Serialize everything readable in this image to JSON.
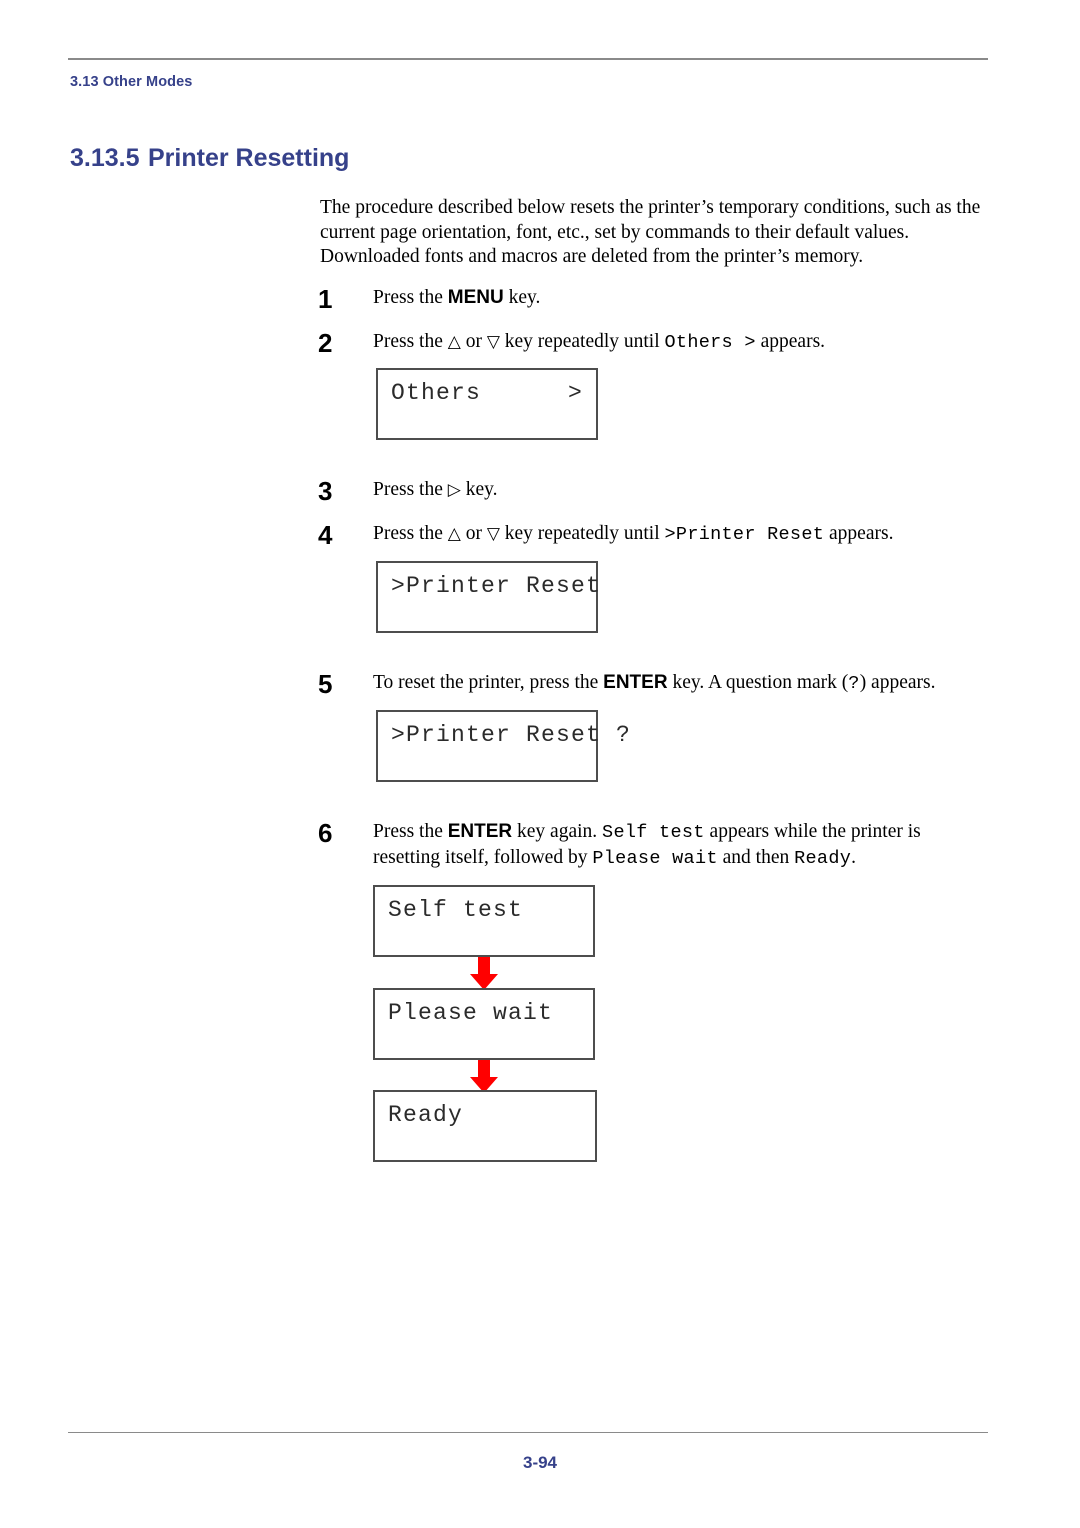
{
  "page": {
    "running_header": "3.13 Other Modes",
    "footer_page_number": "3-94",
    "heading_color": "#36418a",
    "arrow_color": "#ff0000"
  },
  "heading": {
    "number": "3.13.5",
    "title": "Printer Resetting"
  },
  "intro": {
    "paragraph": "The procedure described below resets the printer’s temporary conditions, such as the current page orientation, font, etc., set by commands to their default values. Downloaded fonts and macros are deleted from the printer’s memory."
  },
  "steps": [
    {
      "number": "1",
      "parts": [
        {
          "type": "text",
          "value": "Press the "
        },
        {
          "type": "key",
          "value": "MENU"
        },
        {
          "type": "text",
          "value": " key."
        }
      ]
    },
    {
      "number": "2",
      "parts": [
        {
          "type": "text",
          "value": "Press the "
        },
        {
          "type": "glyph",
          "value": "△"
        },
        {
          "type": "text",
          "value": " or "
        },
        {
          "type": "glyph",
          "value": "▽"
        },
        {
          "type": "text",
          "value": " key repeatedly until "
        },
        {
          "type": "mono",
          "value": "Others >"
        },
        {
          "type": "text",
          "value": " appears."
        }
      ]
    },
    {
      "number": "3",
      "parts": [
        {
          "type": "text",
          "value": "Press the "
        },
        {
          "type": "glyph",
          "value": "▷"
        },
        {
          "type": "text",
          "value": " key."
        }
      ]
    },
    {
      "number": "4",
      "parts": [
        {
          "type": "text",
          "value": "Press the "
        },
        {
          "type": "glyph",
          "value": "△"
        },
        {
          "type": "text",
          "value": " or "
        },
        {
          "type": "glyph",
          "value": "▽"
        },
        {
          "type": "text",
          "value": " key repeatedly until "
        },
        {
          "type": "mono",
          "value": ">Printer Reset"
        },
        {
          "type": "text",
          "value": " appears."
        }
      ]
    },
    {
      "number": "5",
      "parts": [
        {
          "type": "text",
          "value": "To reset the printer, press the "
        },
        {
          "type": "key",
          "value": "ENTER"
        },
        {
          "type": "text",
          "value": " key. A question mark ("
        },
        {
          "type": "mono",
          "value": "?"
        },
        {
          "type": "text",
          "value": ") appears."
        }
      ]
    },
    {
      "number": "6",
      "parts": [
        {
          "type": "text",
          "value": "Press the "
        },
        {
          "type": "key",
          "value": "ENTER"
        },
        {
          "type": "text",
          "value": " key again. "
        },
        {
          "type": "mono",
          "value": "Self test"
        },
        {
          "type": "text",
          "value": " appears while the printer is resetting itself, followed by "
        },
        {
          "type": "mono",
          "value": "Please wait"
        },
        {
          "type": "text",
          "value": " and then "
        },
        {
          "type": "mono",
          "value": "Ready"
        },
        {
          "type": "text",
          "value": "."
        }
      ]
    }
  ],
  "displays": {
    "others": {
      "left": "Others",
      "right": ">"
    },
    "printer_reset": {
      "left": ">Printer Reset",
      "right": ""
    },
    "printer_reset_query": {
      "left": ">Printer Reset ?",
      "right": ""
    },
    "self_test": {
      "left": "Self test",
      "right": ""
    },
    "please_wait": {
      "left": "Please wait",
      "right": ""
    },
    "ready": {
      "left": "Ready",
      "right": ""
    }
  },
  "icons": {
    "up_triangle": "△",
    "down_triangle": "▽",
    "right_triangle": "▷",
    "down_arrow": "down-arrow-icon"
  }
}
